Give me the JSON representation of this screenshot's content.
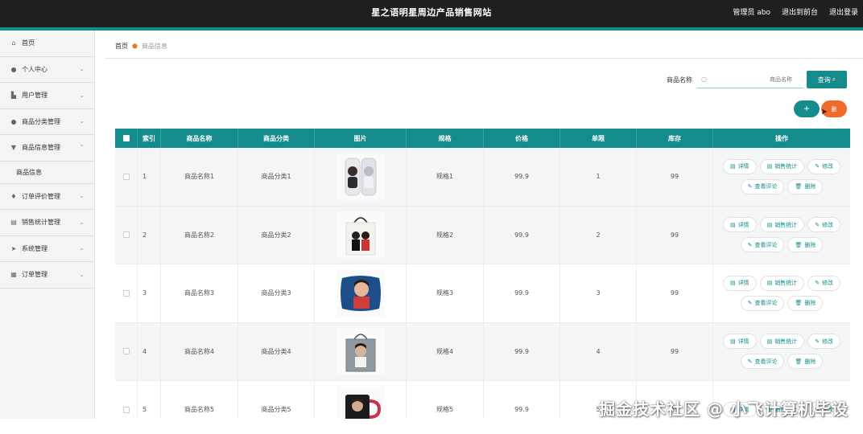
{
  "header": {
    "title": "星之语明星周边产品销售网站",
    "user": "管理员 abo",
    "back_to_front": "退出到前台",
    "logout": "退出登录",
    "accent_color": "#148c8c",
    "bar_color": "#1f1f1f"
  },
  "sidebar": {
    "items": [
      {
        "label": "首页",
        "icon": "home-icon",
        "has_children": false
      },
      {
        "label": "个人中心",
        "icon": "user-icon",
        "has_children": true
      },
      {
        "label": "用户管理",
        "icon": "thumb-icon",
        "has_children": true
      },
      {
        "label": "商品分类管理",
        "icon": "user-icon",
        "has_children": true
      },
      {
        "label": "商品信息管理",
        "icon": "shop-icon",
        "has_children": true
      }
    ],
    "submenu_label": "商品信息",
    "items_after": [
      {
        "label": "订单评价管理",
        "icon": "mic-icon",
        "has_children": true
      },
      {
        "label": "销售统计管理",
        "icon": "list-icon",
        "has_children": true
      },
      {
        "label": "系统管理",
        "icon": "send-icon",
        "has_children": true
      },
      {
        "label": "订单管理",
        "icon": "grid-icon",
        "has_children": true
      }
    ]
  },
  "breadcrumb": {
    "home": "首页",
    "current": "商品信息"
  },
  "search": {
    "label": "商品名称",
    "placeholder": "商品名称",
    "button": "查询"
  },
  "toolbar": {
    "add_symbol": "+",
    "delete_label": "删"
  },
  "table": {
    "columns": [
      "索引",
      "商品名称",
      "商品分类",
      "图片",
      "规格",
      "价格",
      "单限",
      "库存",
      "操作"
    ],
    "rows": [
      {
        "idx": "1",
        "name": "商品名称1",
        "category": "商品分类1",
        "image": "cup-image",
        "spec": "规格1",
        "price": "99.9",
        "limit": "1",
        "stock": "99"
      },
      {
        "idx": "2",
        "name": "商品名称2",
        "category": "商品分类2",
        "image": "tote-bag-image",
        "spec": "规格2",
        "price": "99.9",
        "limit": "2",
        "stock": "99"
      },
      {
        "idx": "3",
        "name": "商品名称3",
        "category": "商品分类3",
        "image": "pillow-image",
        "spec": "规格3",
        "price": "99.9",
        "limit": "3",
        "stock": "99"
      },
      {
        "idx": "4",
        "name": "商品名称4",
        "category": "商品分类4",
        "image": "tote-bag-gray-image",
        "spec": "规格4",
        "price": "99.9",
        "limit": "4",
        "stock": "99"
      },
      {
        "idx": "5",
        "name": "商品名称5",
        "category": "商品分类5",
        "image": "mug-image",
        "spec": "规格5",
        "price": "99.9",
        "limit": "5",
        "stock": "99"
      }
    ],
    "ops": {
      "detail": "详情",
      "sales_stats": "销售统计",
      "edit": "修改",
      "view_reviews": "查看评论",
      "delete": "删除"
    }
  },
  "watermark": "掘金技术社区 @ 小飞计算机毕设"
}
